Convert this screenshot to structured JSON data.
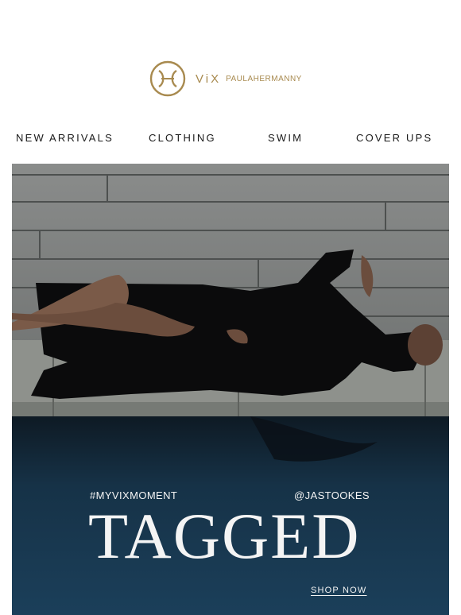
{
  "brand": {
    "logo_text": "ViX",
    "logo_subtext": "PAULAHERMANNY",
    "accent_color": "#a88a4f"
  },
  "nav": {
    "items": [
      "NEW ARRIVALS",
      "CLOTHING",
      "SWIM",
      "COVER UPS"
    ]
  },
  "hero": {
    "hashtag": "#MYVIXMOMENT",
    "handle": "@JASTOOKES",
    "headline": "TAGGED",
    "cta": "SHOP NOW"
  }
}
